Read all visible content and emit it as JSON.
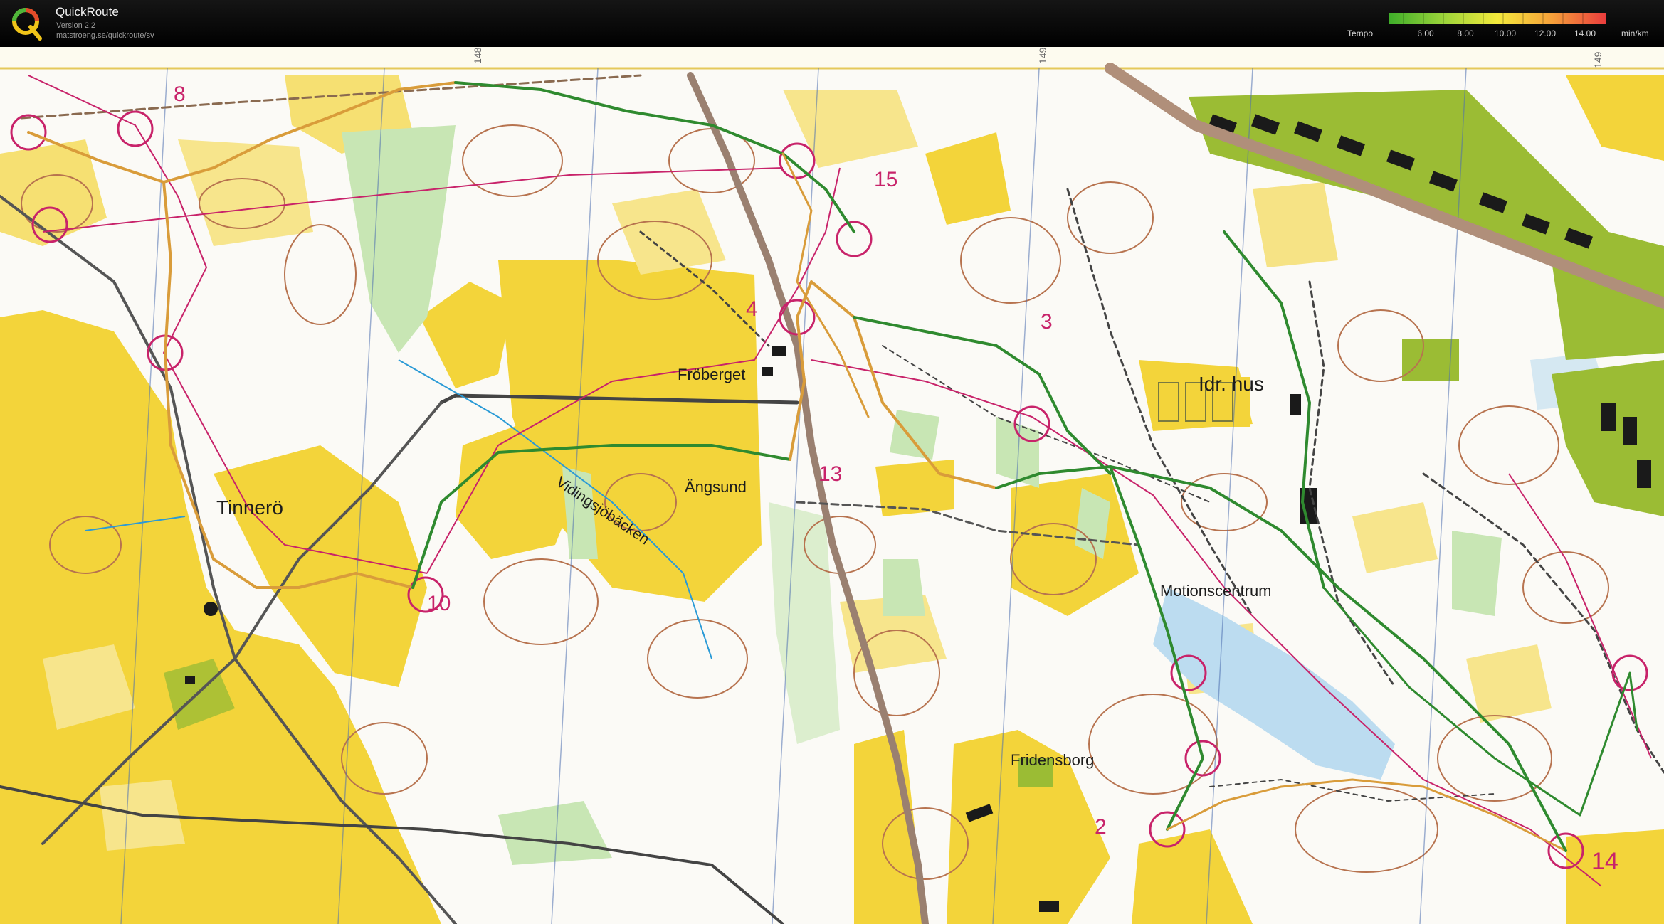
{
  "app": {
    "title": "QuickRoute",
    "version": "Version 2.2",
    "url": "matstroeng.se/quickroute/sv"
  },
  "legend": {
    "label": "Tempo",
    "unit": "min/km",
    "ticks": [
      "6.00",
      "8.00",
      "10.00",
      "12.00",
      "14.00"
    ],
    "gradient_colors": [
      "#3fae2a",
      "#9bd43a",
      "#f4ea3c",
      "#f6a13a",
      "#ea3d3d"
    ]
  },
  "map": {
    "place_names": {
      "froberget": "Fröberget",
      "vidingsjobacken": "Vidingsjöbäcken",
      "angsund": "Ängsund",
      "tinnero": "Tinnerö",
      "idr_hus": "Idr. hus",
      "motionscentrum": "Motionscentrum",
      "fridensborg": "Fridensborg"
    },
    "control_numbers": {
      "c1": "8",
      "c2": "4",
      "c3": "3",
      "c4": "13",
      "c5": "10",
      "c6": "2",
      "c7": "14",
      "c8": "15"
    },
    "colors": {
      "open_land": "#f3d43a",
      "rough_open": "#f7e58c",
      "forest": "#fbfaf6",
      "green": "#c8e6b4",
      "urban": "#9bbc34",
      "building": "#1a1a1a",
      "road": "#b08f7a",
      "water": "#bcdcf0",
      "contour": "#b7734f",
      "course": "#c8236a",
      "route_fast": "#2f8a2f",
      "route_slow": "#d99c3a"
    }
  }
}
